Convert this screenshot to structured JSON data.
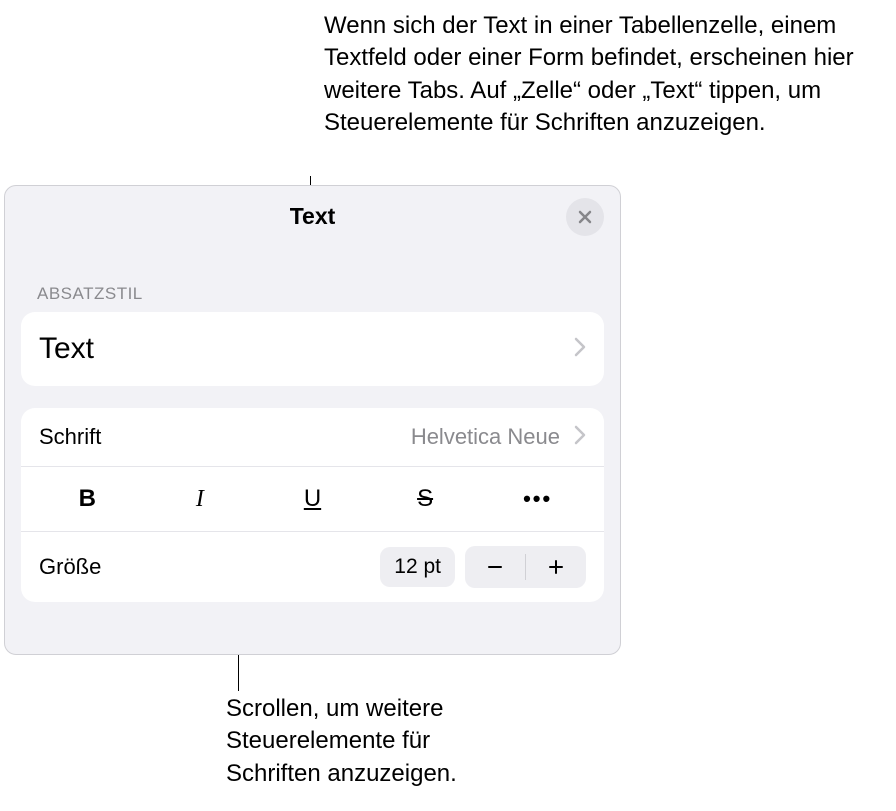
{
  "annotations": {
    "top": "Wenn sich der Text in einer Tabellenzelle, einem Textfeld oder einer Form befindet, erscheinen hier weitere Tabs. Auf „Zelle“ oder „Text“ tippen, um Steuerelemente für Schriften anzuzeigen.",
    "bottom": "Scrollen, um weitere Steuerelemente für Schriften anzuzeigen."
  },
  "panel": {
    "title": "Text",
    "section_label": "ABSATZSTIL",
    "paragraph_style": "Text",
    "font": {
      "label": "Schrift",
      "value": "Helvetica Neue"
    },
    "styles": {
      "bold": "B",
      "italic": "I",
      "underline": "U",
      "strike": "S",
      "more": "•••"
    },
    "size": {
      "label": "Größe",
      "value": "12 pt"
    }
  }
}
